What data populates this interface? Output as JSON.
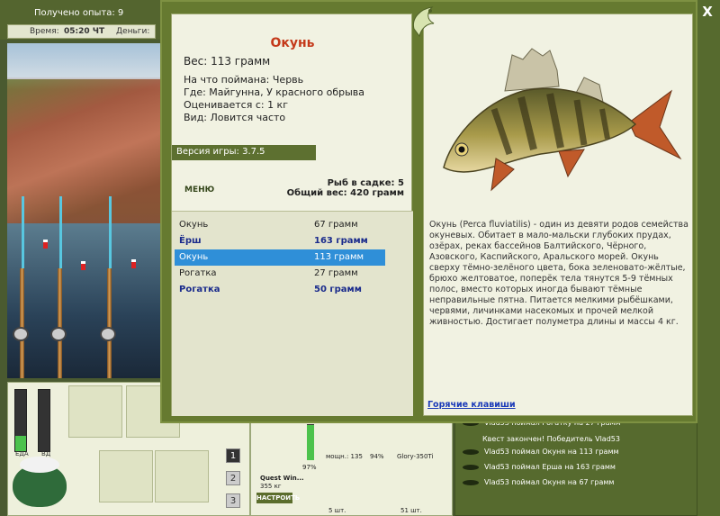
{
  "hud": {
    "experience_label": "Получено опыта: 9",
    "time_label": "Время:",
    "time_value": "05:20 ЧТ",
    "money_label": "Деньги:"
  },
  "gauges": {
    "food_label": "ЕДА",
    "food_level": 0.25,
    "second_label": "ВД",
    "second_level": 0.0
  },
  "pages": [
    "1",
    "2",
    "3"
  ],
  "shop": {
    "rod_name": "Quest Win...",
    "rod_weight": "355 кг",
    "rod_percent": "97%",
    "reel_label": "мощн.: 135",
    "reel_percent": "94%",
    "line_name": "Glory-350Ti",
    "hook_qty": "5 шт.",
    "bait_qty": "51 шт.",
    "setup_button": "НАСТРОИТЬ"
  },
  "log": [
    {
      "text": "Vlad53 поймал Рогатку на 27 грамм",
      "icon": "fish-icon"
    },
    {
      "text": "Квест закончен! Победитель Vlad53",
      "icon": ""
    },
    {
      "text": "Vlad53 поймал Окуня на 113 грамм",
      "icon": "fish-icon"
    },
    {
      "text": "Vlad53 поймал Ерша на 163 грамм",
      "icon": "fish-icon"
    },
    {
      "text": "Vlad53 поймал Окуня на 67 грамм",
      "icon": "fish-icon"
    }
  ],
  "dialog": {
    "fish_name": "Окунь",
    "weight": "Вес: 113 грамм",
    "bait": "На что поймана: Червь",
    "location": "Где: Майгунна, У красного обрыва",
    "value": "Оценивается с: 1 кг",
    "type": "Вид: Ловится часто",
    "version": "Версия игры: 3.7.5",
    "menu_button": "МЕНЮ",
    "cage_count": "Рыб в садке: 5",
    "total_weight": "Общий вес: 420 грамм",
    "catches": [
      {
        "name": "Окунь",
        "weight": "67 грамм",
        "style": "normal"
      },
      {
        "name": "Ёрш",
        "weight": "163 грамм",
        "style": "bold"
      },
      {
        "name": "Окунь",
        "weight": "113 грамм",
        "style": "selected"
      },
      {
        "name": "Рогатка",
        "weight": "27 грамм",
        "style": "normal"
      },
      {
        "name": "Рогатка",
        "weight": "50 грамм",
        "style": "bold"
      }
    ],
    "description": "Окунь (Perca fluviatilis) - один из девяти родов семейства окуневых. Обитает в мало-мальски глубоких прудах, озёрах, реках бассейнов Балтийского, Чёрного, Азовского, Каспийского, Аральского морей. Окунь сверху тёмно-зелёного цвета, бока зеленовато-жёлтые, брюхо желтоватое, поперёк тела тянутся 5-9 тёмных полос, вместо которых иногда бывают тёмные неправильные пятна. Питается мелкими рыбёшками, червями, личинками насекомых и прочей мелкой живностью. Достигает полуметра длины и массы 4 кг.",
    "hotkeys_link": "Горячие клавиши",
    "close_label": "X"
  }
}
